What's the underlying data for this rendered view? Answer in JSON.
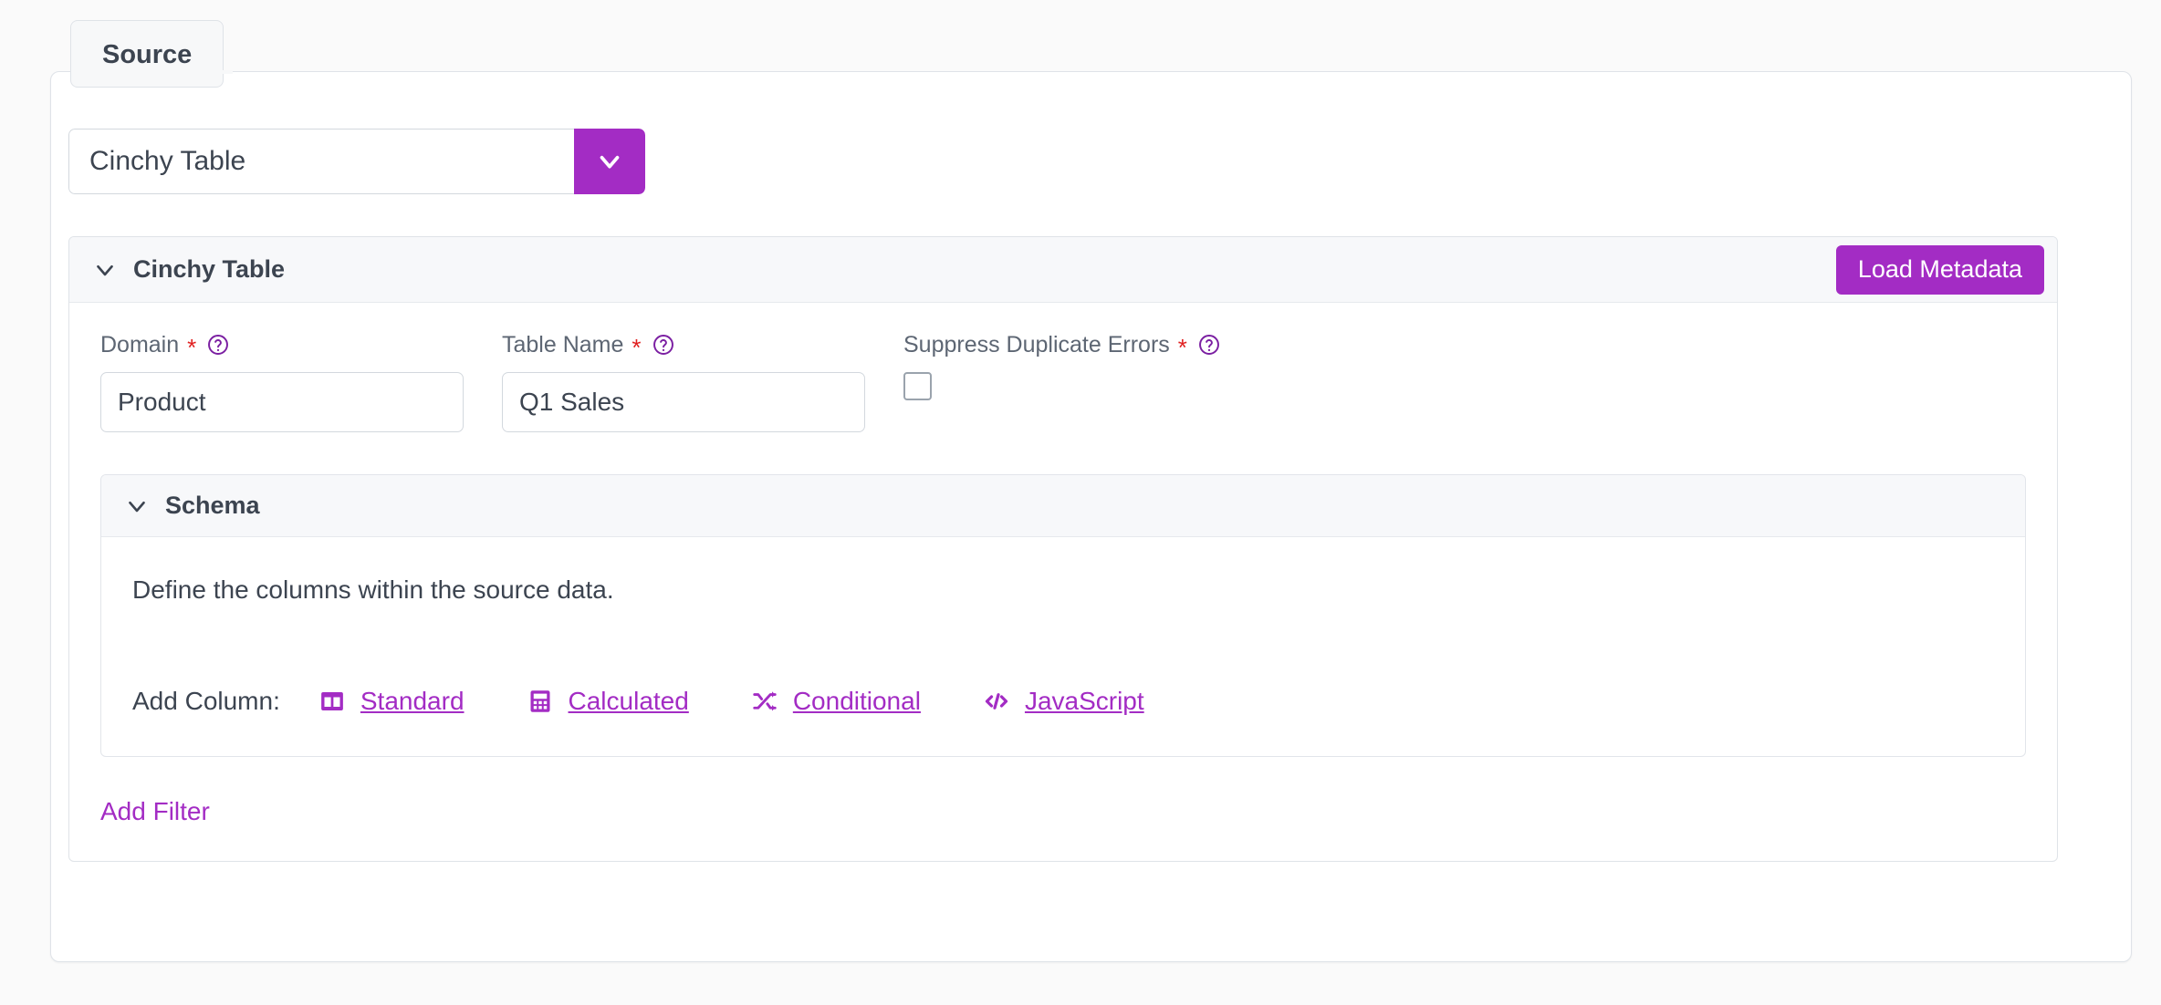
{
  "tab": {
    "label": "Source"
  },
  "source_type": {
    "value": "Cinchy Table",
    "dropdown_icon": "chevron-down-icon"
  },
  "card": {
    "title": "Cinchy Table",
    "collapse_icon": "chevron-down-icon",
    "load_metadata_label": "Load Metadata",
    "fields": {
      "domain": {
        "label": "Domain",
        "required_marker": "*",
        "help_icon": "help-circle-icon",
        "value": "Product",
        "placeholder": ""
      },
      "table_name": {
        "label": "Table Name",
        "required_marker": "*",
        "help_icon": "help-circle-icon",
        "value": "Q1 Sales",
        "placeholder": ""
      },
      "suppress_duplicate_errors": {
        "label": "Suppress Duplicate Errors",
        "required_marker": "*",
        "help_icon": "help-circle-icon",
        "checked": false
      }
    }
  },
  "schema": {
    "title": "Schema",
    "collapse_icon": "chevron-down-icon",
    "description": "Define the columns within the source data.",
    "add_column_label": "Add Column:",
    "add_column_options": [
      {
        "label": "Standard",
        "icon": "columns-icon"
      },
      {
        "label": "Calculated",
        "icon": "calculator-icon"
      },
      {
        "label": "Conditional",
        "icon": "shuffle-icon"
      },
      {
        "label": "JavaScript",
        "icon": "code-icon"
      }
    ]
  },
  "add_filter": {
    "label": "Add Filter"
  },
  "colors": {
    "accent_purple": "#a32cc4",
    "required_red": "#e02020",
    "text_dark": "#3c4450",
    "label_gray": "#5d6673",
    "border_gray": "#dfe3e8",
    "header_bg": "#f7f8fa",
    "page_bg": "#fafafa"
  }
}
